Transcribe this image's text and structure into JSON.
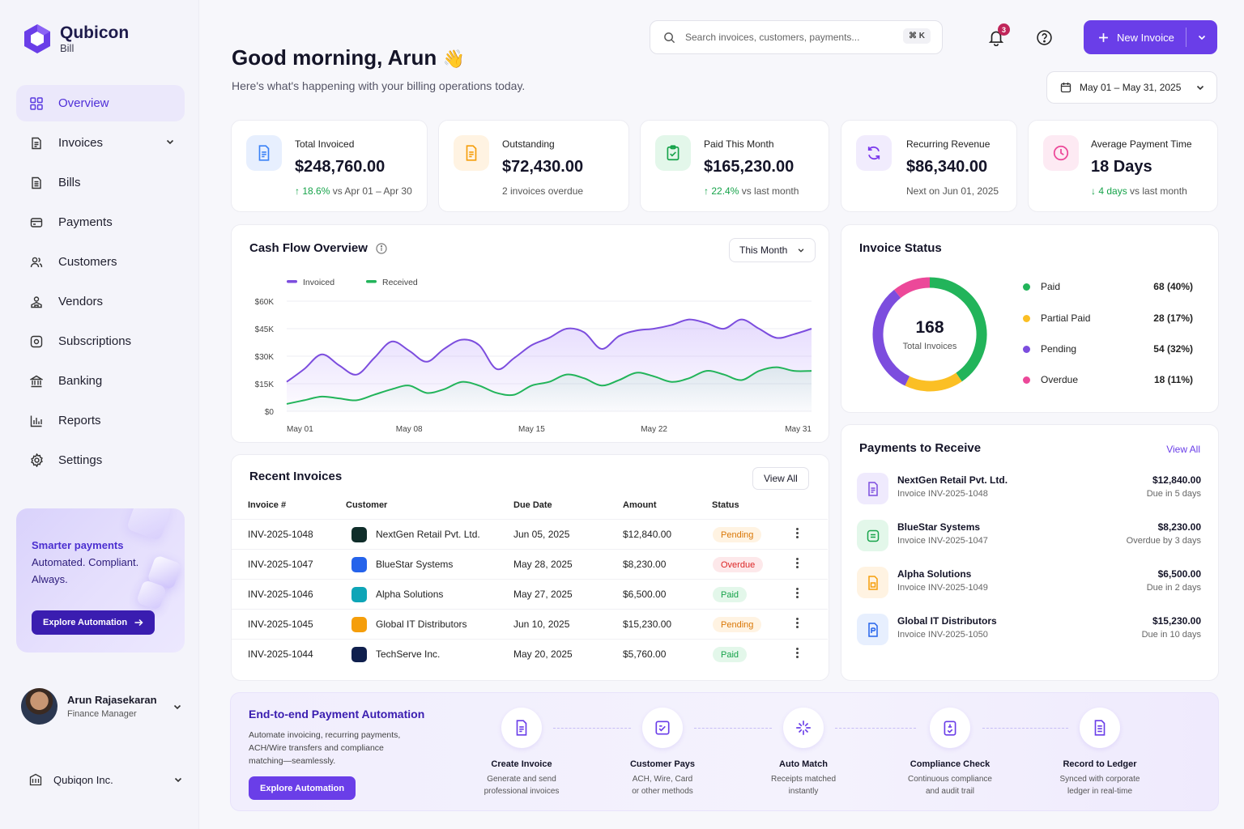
{
  "brand": {
    "name": "Qubicon",
    "sub": "Bill"
  },
  "nav": [
    {
      "label": "Overview",
      "icon": "grid-icon"
    },
    {
      "label": "Invoices",
      "icon": "invoice-icon"
    },
    {
      "label": "Bills",
      "icon": "bill-icon"
    },
    {
      "label": "Payments",
      "icon": "wallet-icon"
    },
    {
      "label": "Customers",
      "icon": "users-icon"
    },
    {
      "label": "Vendors",
      "icon": "vendor-icon"
    },
    {
      "label": "Subscriptions",
      "icon": "subscription-icon"
    },
    {
      "label": "Banking",
      "icon": "bank-icon"
    },
    {
      "label": "Reports",
      "icon": "chart-icon"
    },
    {
      "label": "Settings",
      "icon": "gear-icon"
    }
  ],
  "promo": {
    "line1": "Smarter payments",
    "line2": "Automated. Compliant.",
    "line3": "Always.",
    "button": "Explore Automation"
  },
  "user": {
    "name": "Arun Rajasekaran",
    "role": "Finance Manager"
  },
  "org": {
    "name": "Qubiqon Inc."
  },
  "header": {
    "greeting": "Good morning, Arun",
    "wave": "👋",
    "subtitle": "Here's what's happening with your billing operations today.",
    "search_placeholder": "Search invoices, customers, payments...",
    "search_shortcut": "⌘ K",
    "notifications": "3",
    "new_invoice": "New Invoice",
    "date_range": "May 01 – May 31, 2025"
  },
  "stats": [
    {
      "label": "Total Invoiced",
      "value": "$248,760.00",
      "delta": "18.6%",
      "note": "vs Apr 01 – Apr 30",
      "color": "#3b82f6"
    },
    {
      "label": "Outstanding",
      "value": "$72,430.00",
      "note": "2 invoices overdue",
      "color": "#f59e0b"
    },
    {
      "label": "Paid This Month",
      "value": "$165,230.00",
      "delta": "22.4%",
      "note": "vs last month",
      "color": "#16a34a"
    },
    {
      "label": "Recurring Revenue",
      "value": "$86,340.00",
      "note": "Next on Jun 01, 2025",
      "color": "#7c3aed"
    },
    {
      "label": "Average Payment Time",
      "value": "18 Days",
      "delta": "4 days",
      "note": "vs last month",
      "color": "#ec4899"
    }
  ],
  "cashflow": {
    "title": "Cash Flow Overview",
    "period": "This Month"
  },
  "chart_data": {
    "type": "area",
    "title": "Cash Flow Overview",
    "series": [
      {
        "name": "Invoiced",
        "color": "#7c4dde",
        "values": [
          16,
          23,
          31,
          25,
          20,
          29,
          38,
          33,
          27,
          34,
          39,
          36,
          23,
          29,
          36,
          40,
          45,
          43,
          34,
          41,
          44,
          45,
          47,
          50,
          48,
          45,
          50,
          45,
          40,
          42,
          45
        ]
      },
      {
        "name": "Received",
        "color": "#22b45a",
        "values": [
          4,
          6,
          8,
          7,
          6,
          9,
          12,
          14,
          10,
          12,
          16,
          14,
          10,
          9,
          14,
          16,
          20,
          18,
          14,
          17,
          21,
          19,
          16,
          18,
          22,
          20,
          17,
          22,
          24,
          22,
          22
        ]
      }
    ],
    "x_tick_labels": [
      "May 01",
      "May 08",
      "May 15",
      "May 22",
      "May 31"
    ],
    "y_tick_labels": [
      "$60K",
      "$45K",
      "$30K",
      "$15K",
      "$0"
    ],
    "ylim": [
      0,
      60
    ],
    "grid": true,
    "legend": "top-left"
  },
  "invoice_status": {
    "title": "Invoice Status",
    "total": "168",
    "total_label": "Total Invoices",
    "items": [
      {
        "label": "Paid",
        "value": "68 (40%)",
        "count": 68,
        "color": "#22b45a"
      },
      {
        "label": "Partial Paid",
        "value": "28 (17%)",
        "count": 28,
        "color": "#fbbf24"
      },
      {
        "label": "Pending",
        "value": "54 (32%)",
        "count": 54,
        "color": "#7c4dde"
      },
      {
        "label": "Overdue",
        "value": "18 (11%)",
        "count": 18,
        "color": "#ec4899"
      }
    ]
  },
  "recent": {
    "title": "Recent Invoices",
    "view_all": "View All",
    "columns": [
      "Invoice #",
      "Customer",
      "Due Date",
      "Amount",
      "Status"
    ],
    "rows": [
      {
        "id": "INV-2025-1048",
        "customer": "NextGen Retail Pvt. Ltd.",
        "due": "Jun 05, 2025",
        "amount": "$12,840.00",
        "status": "Pending",
        "icon_color": "#0f2d2a"
      },
      {
        "id": "INV-2025-1047",
        "customer": "BlueStar Systems",
        "due": "May 28, 2025",
        "amount": "$8,230.00",
        "status": "Overdue",
        "icon_color": "#2563eb"
      },
      {
        "id": "INV-2025-1046",
        "customer": "Alpha Solutions",
        "due": "May 27, 2025",
        "amount": "$6,500.00",
        "status": "Paid",
        "icon_color": "#0ea5b7"
      },
      {
        "id": "INV-2025-1045",
        "customer": "Global IT Distributors",
        "due": "Jun 10, 2025",
        "amount": "$15,230.00",
        "status": "Pending",
        "icon_color": "#f59e0b"
      },
      {
        "id": "INV-2025-1044",
        "customer": "TechServe Inc.",
        "due": "May 20, 2025",
        "amount": "$5,760.00",
        "status": "Paid",
        "icon_color": "#0f1f4d"
      }
    ]
  },
  "payments": {
    "title": "Payments to Receive",
    "view_all": "View All",
    "items": [
      {
        "name": "NextGen Retail Pvt. Ltd.",
        "invoice": "Invoice INV-2025-1048",
        "amount": "$12,840.00",
        "due": "Due in 5 days",
        "color": "#7c4dde",
        "bg": "#efeafd"
      },
      {
        "name": "BlueStar Systems",
        "invoice": "Invoice INV-2025-1047",
        "amount": "$8,230.00",
        "due": "Overdue by 3 days",
        "color": "#16a34a",
        "bg": "#e3f7ea"
      },
      {
        "name": "Alpha Solutions",
        "invoice": "Invoice INV-2025-1049",
        "amount": "$6,500.00",
        "due": "Due in 2 days",
        "color": "#f59e0b",
        "bg": "#fff3e2"
      },
      {
        "name": "Global IT Distributors",
        "invoice": "Invoice INV-2025-1050",
        "amount": "$15,230.00",
        "due": "Due in 10 days",
        "color": "#2563eb",
        "bg": "#e7effe"
      }
    ]
  },
  "automation": {
    "title": "End-to-end Payment Automation",
    "desc": "Automate invoicing, recurring payments, ACH/Wire transfers and compliance matching—seamlessly.",
    "button": "Explore Automation",
    "steps": [
      {
        "title": "Create Invoice",
        "line1": "Generate and send",
        "line2": "professional invoices"
      },
      {
        "title": "Customer Pays",
        "line1": "ACH, Wire, Card",
        "line2": "or other methods"
      },
      {
        "title": "Auto Match",
        "line1": "Receipts matched",
        "line2": "instantly"
      },
      {
        "title": "Compliance Check",
        "line1": "Continuous compliance",
        "line2": "and audit trail"
      },
      {
        "title": "Record to Ledger",
        "line1": "Synced with corporate",
        "line2": "ledger in real-time"
      }
    ]
  }
}
